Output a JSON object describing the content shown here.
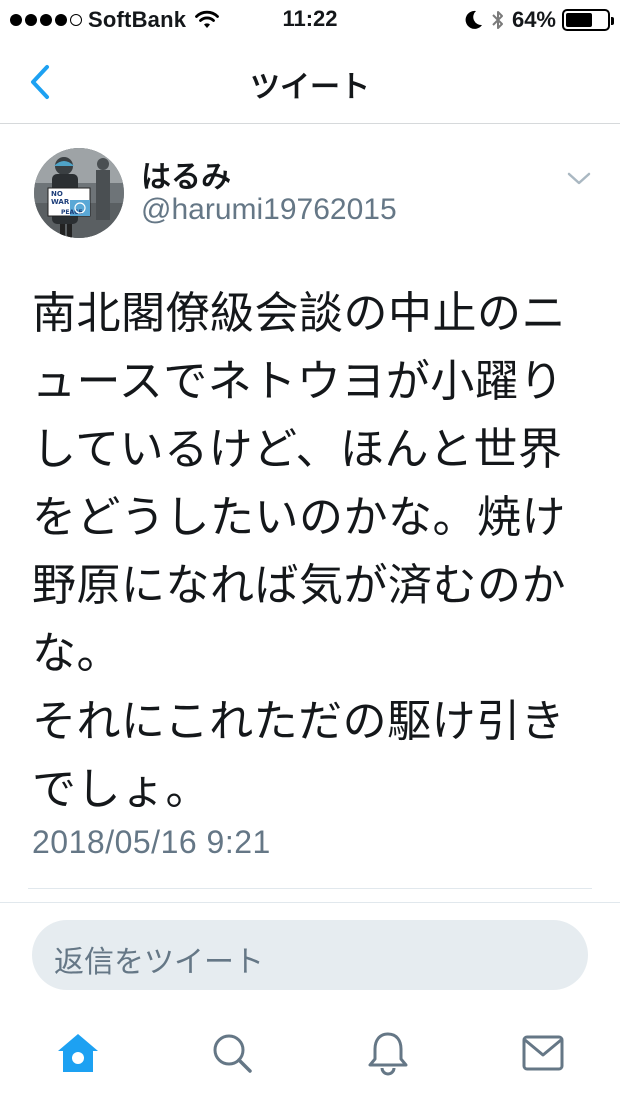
{
  "status_bar": {
    "carrier": "SoftBank",
    "time": "11:22",
    "battery_percent": "64%",
    "battery_level": 0.64,
    "signal_bars_filled": 4,
    "signal_bars_total": 5
  },
  "nav": {
    "title": "ツイート",
    "back_icon": "chevron-left-icon"
  },
  "tweet": {
    "user_name": "はるみ",
    "user_handle": "@harumi19762015",
    "avatar_sign_text": [
      "NO",
      "WAR",
      "PEACE"
    ],
    "text": "南北閣僚級会談の中止のニュースでネトウヨが小躍りしているけど、ほんと世界をどうしたいのかな。焼け野原になれば気が済むのかな。\nそれにこれただの駆け引きでしょ。",
    "timestamp": "2018/05/16 9:21"
  },
  "reply": {
    "placeholder": "返信をツイート"
  },
  "tabs": [
    {
      "icon": "home-icon",
      "active": true
    },
    {
      "icon": "search-icon",
      "active": false
    },
    {
      "icon": "notifications-bell-icon",
      "active": false
    },
    {
      "icon": "messages-envelope-icon",
      "active": false
    }
  ],
  "colors": {
    "accent": "#1da1f2",
    "text": "#14171a",
    "secondary_text": "#657786",
    "inactive_icon": "#657786",
    "reply_bg": "#e6ecf0",
    "divider": "#e1e8ed"
  }
}
